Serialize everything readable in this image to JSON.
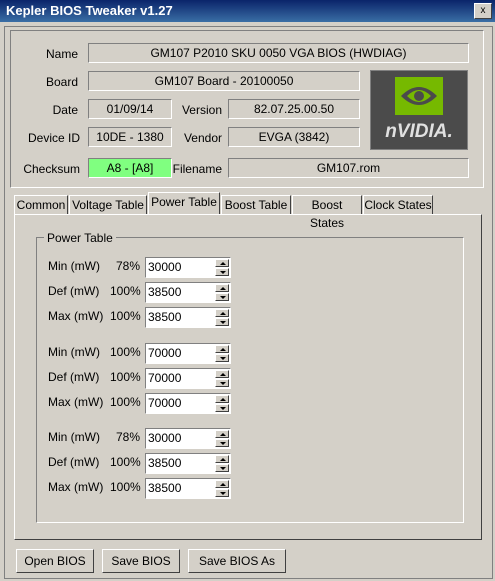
{
  "window": {
    "title": "Kepler BIOS Tweaker v1.27"
  },
  "info": {
    "name_label": "Name",
    "name_value": "GM107 P2010 SKU 0050 VGA BIOS (HWDIAG)",
    "board_label": "Board",
    "board_value": "GM107 Board - 20100050",
    "date_label": "Date",
    "date_value": "01/09/14",
    "version_label": "Version",
    "version_value": "82.07.25.00.50",
    "device_label": "Device ID",
    "device_value": "10DE - 1380",
    "vendor_label": "Vendor",
    "vendor_value": "EVGA (3842)",
    "checksum_label": "Checksum",
    "checksum_value": "A8 - [A8]",
    "filename_label": "Filename",
    "filename_value": "GM107.rom",
    "checksum_color": "#80ff80"
  },
  "logo": {
    "text": "nVIDIA.",
    "icon": "nvidia-eye-logo"
  },
  "tabs": [
    "Common",
    "Voltage Table",
    "Power Table",
    "Boost Table",
    "Boost States",
    "Clock States"
  ],
  "active_tab": "Power Table",
  "power_table": {
    "group_label": "Power Table",
    "rows": [
      {
        "label": "Min (mW)",
        "pct": "78%",
        "value": "30000"
      },
      {
        "label": "Def (mW)",
        "pct": "100%",
        "value": "38500"
      },
      {
        "label": "Max (mW)",
        "pct": "100%",
        "value": "38500"
      },
      {
        "label": "Min (mW)",
        "pct": "100%",
        "value": "70000"
      },
      {
        "label": "Def (mW)",
        "pct": "100%",
        "value": "70000"
      },
      {
        "label": "Max (mW)",
        "pct": "100%",
        "value": "70000"
      },
      {
        "label": "Min (mW)",
        "pct": "78%",
        "value": "30000"
      },
      {
        "label": "Def (mW)",
        "pct": "100%",
        "value": "38500"
      },
      {
        "label": "Max (mW)",
        "pct": "100%",
        "value": "38500"
      }
    ]
  },
  "buttons": {
    "open": "Open BIOS",
    "save": "Save BIOS",
    "save_as": "Save BIOS As"
  },
  "title_buttons": {
    "close": "x"
  }
}
